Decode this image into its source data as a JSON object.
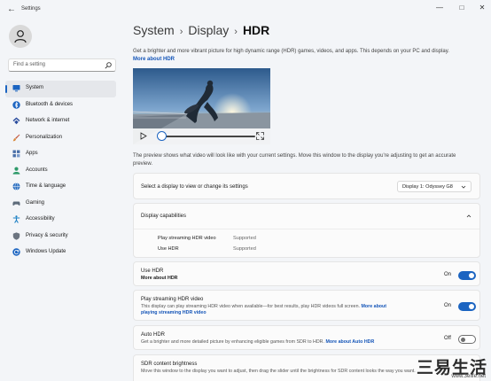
{
  "window": {
    "title": "Settings"
  },
  "search": {
    "placeholder": "Find a setting"
  },
  "sidebar": {
    "items": [
      {
        "label": "System",
        "icon": "monitor-icon",
        "color": "#1b64c1",
        "active": true
      },
      {
        "label": "Bluetooth & devices",
        "icon": "bluetooth-icon",
        "color": "#1b64c1"
      },
      {
        "label": "Network & internet",
        "icon": "network-icon",
        "color": "#2b4d9e"
      },
      {
        "label": "Personalization",
        "icon": "brush-icon",
        "color": "#c2553e"
      },
      {
        "label": "Apps",
        "icon": "apps-icon",
        "color": "#4a6fa8"
      },
      {
        "label": "Accounts",
        "icon": "person-icon",
        "color": "#2e9a6a"
      },
      {
        "label": "Time & language",
        "icon": "globe-icon",
        "color": "#2b6fc1"
      },
      {
        "label": "Gaming",
        "icon": "gamepad-icon",
        "color": "#5d6b7a"
      },
      {
        "label": "Accessibility",
        "icon": "accessibility-icon",
        "color": "#1a7fc4"
      },
      {
        "label": "Privacy & security",
        "icon": "shield-icon",
        "color": "#6b7480"
      },
      {
        "label": "Windows Update",
        "icon": "update-icon",
        "color": "#1b64c1"
      }
    ]
  },
  "breadcrumb": {
    "level1": "System",
    "level2": "Display",
    "current": "HDR"
  },
  "intro": {
    "text": "Get a brighter and more vibrant picture for high dynamic range (HDR) games, videos, and apps. This depends on your PC and display.",
    "link": "More about HDR"
  },
  "preview": {
    "note": "The preview shows what video will look like with your current settings. Move this window to the display you're adjusting to get an accurate preview.",
    "progress": 0
  },
  "display_select": {
    "label": "Select a display to view or change its settings",
    "value": "Display 1: Odyssey G8"
  },
  "capabilities": {
    "title": "Display capabilities",
    "rows": [
      {
        "name": "Play streaming HDR video",
        "value": "Supported"
      },
      {
        "name": "Use HDR",
        "value": "Supported"
      }
    ]
  },
  "use_hdr": {
    "label": "Use HDR",
    "link": "More about HDR",
    "state": "On"
  },
  "streaming_hdr": {
    "label": "Play streaming HDR video",
    "desc": "This display can play streaming HDR video when available—for best results, play HDR videos full screen.",
    "link1": "More about",
    "link2": "playing streaming HDR video",
    "state": "On"
  },
  "auto_hdr": {
    "label": "Auto HDR",
    "desc": "Get a brighter and more detailed picture by enhancing eligible games from SDR to HDR.",
    "link": "More about Auto HDR",
    "state": "Off"
  },
  "sdr_brightness": {
    "label": "SDR content brightness",
    "desc": "Move this window to the display you want to adjust, then drag the slider until the brightness for SDR content looks the way you want."
  },
  "watermark": {
    "chinese": "三易生活",
    "url": "www.3elife.net"
  },
  "colors": {
    "accent": "#1b64c1",
    "link": "#1455b8"
  }
}
